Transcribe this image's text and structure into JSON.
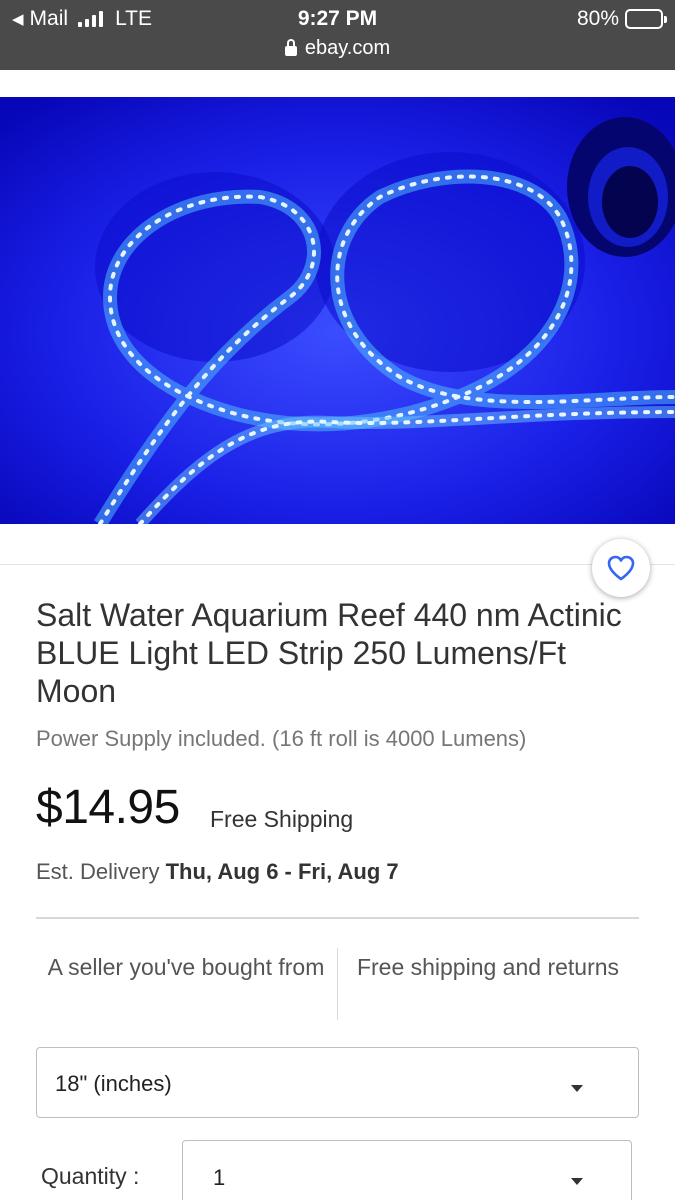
{
  "status_bar": {
    "back_label": "Mail",
    "network": "LTE",
    "time": "9:27 PM",
    "url": "ebay.com",
    "battery": "80%",
    "battery_level": 0.8,
    "icons": [
      "back-arrow-icon",
      "signal-bars-icon",
      "lock-icon",
      "battery-icon"
    ]
  },
  "product": {
    "image_alt_icon": "led-strip-photo",
    "watch_icon": "heart-icon",
    "title": "Salt Water Aquarium Reef 440 nm Actinic BLUE Light LED Strip 250 Lumens/Ft Moon",
    "subtitle": "Power Supply included. (16 ft roll is 4000 Lumens)",
    "price": "$14.95",
    "shipping": "Free Shipping",
    "delivery_prefix": "Est. Delivery",
    "delivery_dates": "Thu, Aug 6 - Fri, Aug 7"
  },
  "badges": [
    {
      "label": "A seller you've bought from"
    },
    {
      "label": "Free shipping and returns"
    }
  ],
  "options": {
    "variant_value": "18\" (inches)",
    "quantity_label": "Quantity :",
    "quantity_value": "1"
  },
  "colors": {
    "status_bar_bg": "#4a4a4a",
    "image_bg": "#0a0bd8",
    "watch_heart": "#3665f3",
    "text_primary": "#333333",
    "text_secondary": "#767676"
  }
}
